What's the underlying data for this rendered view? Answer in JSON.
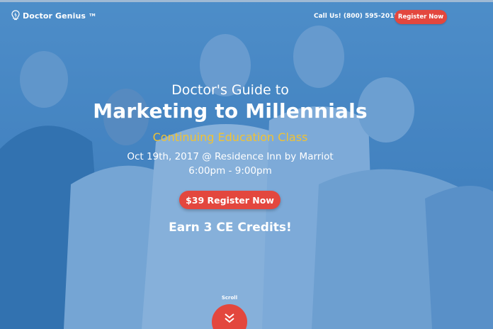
{
  "header": {
    "logo_text": "Doctor Genius",
    "logo_tm": "TM",
    "phone": "Call Us! (800) 595-2018",
    "register_label": "Register Now"
  },
  "hero": {
    "pre_title": "Doctor's Guide to",
    "title": "Marketing to Millennials",
    "subtitle": "Continuing Education Class",
    "date_location": "Oct 19th, 2017 @ Residence Inn by Marriot",
    "time": "6:00pm - 9:00pm",
    "register_label": "$39 Register Now",
    "credits": "Earn 3 CE Credits!"
  },
  "scroll": {
    "label": "Scroll"
  },
  "colors": {
    "accent_red": "#e3473e",
    "highlight_yellow": "#f1c232",
    "overlay_blue": "#3f80bd"
  },
  "icons": {
    "logo": "lightbulb-icon",
    "scroll": "double-chevron-down-icon"
  }
}
